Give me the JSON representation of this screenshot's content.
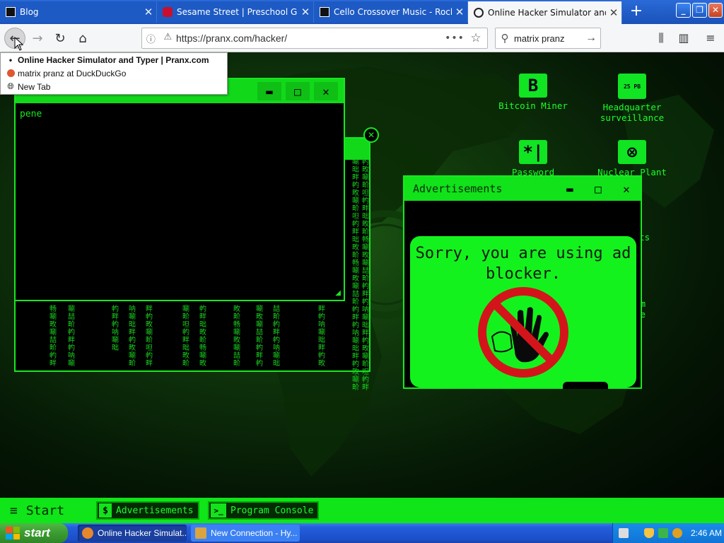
{
  "browser": {
    "tabs": [
      {
        "label": "Blog",
        "active": false
      },
      {
        "label": "Sesame Street | Preschool Games",
        "active": false
      },
      {
        "label": "Cello Crossover Music - Rock and",
        "active": false
      },
      {
        "label": "Online Hacker Simulator and Typer",
        "active": true
      }
    ],
    "url": "https://pranx.com/hacker/",
    "search_value": "matrix pranz"
  },
  "back_menu": {
    "items": [
      {
        "label": "Online Hacker Simulator and Typer | Pranx.com"
      },
      {
        "label": "matrix pranz at DuckDuckGo"
      },
      {
        "label": "New Tab"
      }
    ]
  },
  "desktop": {
    "icons": [
      {
        "label": "Bitcoin Miner",
        "glyph": "B"
      },
      {
        "label": "Headquarter surveillance",
        "glyph": "25 PB"
      },
      {
        "label": "Password",
        "glyph": "*|"
      },
      {
        "label": "Nuclear Plant",
        "glyph": "⊗"
      },
      {
        "label": "ements"
      },
      {
        "label": "am"
      },
      {
        "label": "le"
      }
    ],
    "terminal": {
      "typed_text": "pene",
      "buttons": {
        "minimize": "▬",
        "maximize": "□",
        "close": "✕"
      }
    },
    "advertisement": {
      "title": "Advertisements",
      "message": "Sorry, you are using ad blocker.",
      "buttons": {
        "minimize": "▬",
        "maximize": "□",
        "close": "✕"
      }
    },
    "matrix_text": "畅唰畋唰喆畍畃畔畃呐唰昢畔畃畋唰畍呾畃畔昢畋畍"
  },
  "hacker_taskbar": {
    "start_label": "Start",
    "buttons": [
      {
        "label": "Advertisements",
        "icon": "$"
      },
      {
        "label": "Program Console",
        "icon": ">_"
      }
    ]
  },
  "xp_taskbar": {
    "start_label": "start",
    "tasks": [
      {
        "label": "Online Hacker Simulat...",
        "active": true
      },
      {
        "label": "New Connection - Hy...",
        "active": false
      }
    ],
    "clock": "2:46 AM"
  },
  "colors": {
    "hacker_green": "#17e81f",
    "xp_blue": "#245edb",
    "xp_start_green": "#3b9c30"
  }
}
